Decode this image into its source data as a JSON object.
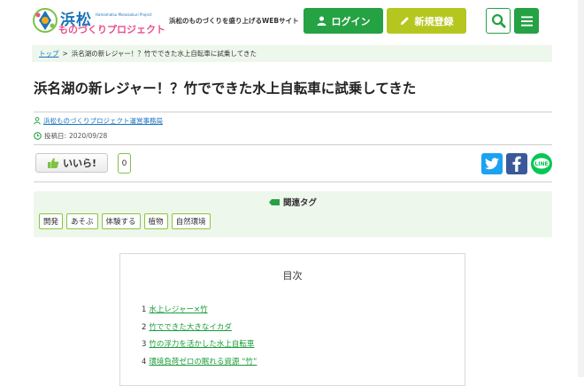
{
  "header": {
    "logo_title": "浜松",
    "logo_en": "Hamamatsu Monozukuri Project",
    "logo_sub": "ものづくりプロジェクト",
    "tagline": "浜松のものづくりを盛り上げるWEBサイト",
    "login_label": "ログイン",
    "register_label": "新規登録"
  },
  "breadcrumb": {
    "home": "トップ",
    "separator": ">",
    "current": "浜名湖の新レジャー！？竹でできた水上自転車に試乗してきた"
  },
  "article": {
    "title": "浜名湖の新レジャー！？竹でできた水上自転車に試乗してきた",
    "author": "浜松ものづくりプロジェクト運営事務局",
    "date_label": "投稿日:",
    "date": "2020/09/28",
    "like_label": "いいら!",
    "like_count": "0"
  },
  "tags": {
    "heading": "関連タグ",
    "items": [
      "開発",
      "あそぶ",
      "体験する",
      "植物",
      "自然環境"
    ]
  },
  "toc": {
    "title": "目次",
    "items": [
      {
        "num": "1",
        "label": "水上レジャー×竹"
      },
      {
        "num": "2",
        "label": "竹でできた大きなイカダ"
      },
      {
        "num": "3",
        "label": "竹の浮力を活かした水上自転車"
      },
      {
        "num": "4",
        "label": "環境負荷ゼロの眠れる資源 “竹”"
      }
    ]
  },
  "colors": {
    "brand_green": "#25a244",
    "register_lime": "#b5c71f",
    "link_blue": "#1a73c0",
    "tag_bg": "#eef7ec"
  }
}
